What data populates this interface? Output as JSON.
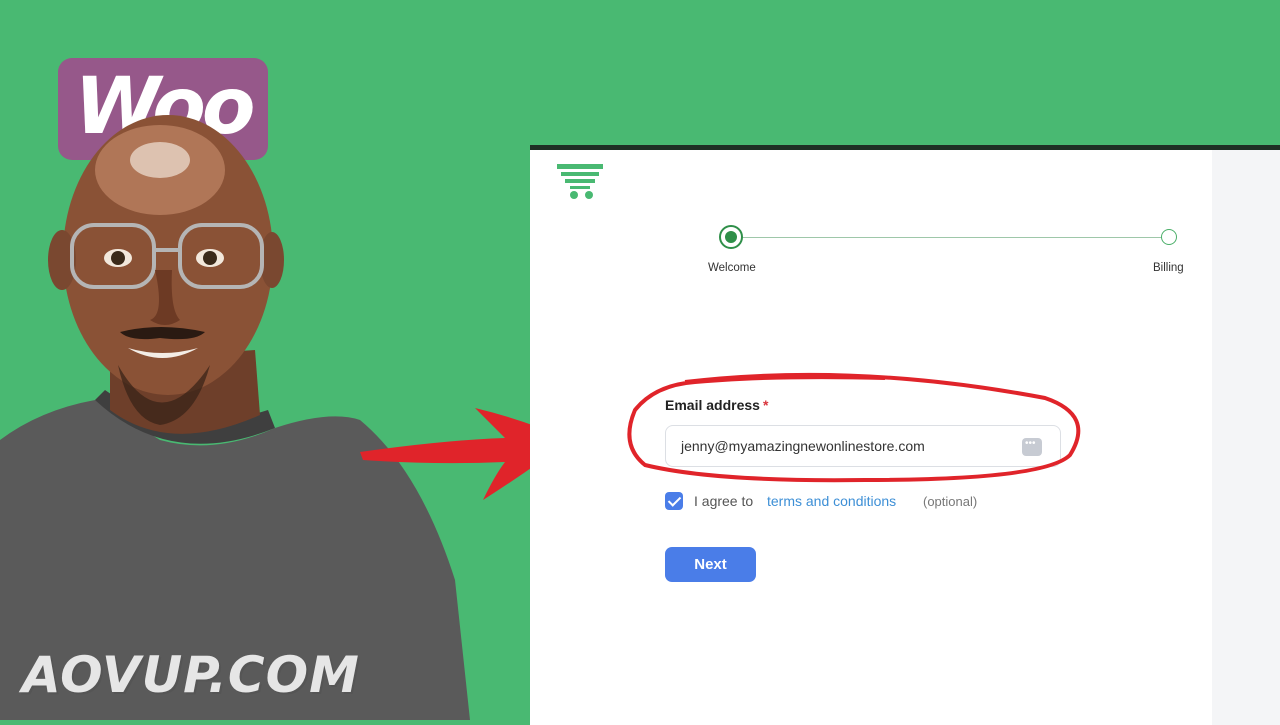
{
  "left": {
    "logo_text": "Woo",
    "watermark": "AOVUP.COM"
  },
  "app": {
    "steps": [
      {
        "label": "Welcome",
        "state": "active"
      },
      {
        "label": "Billing",
        "state": "inactive"
      }
    ],
    "email": {
      "label": "Email address",
      "required_mark": "*",
      "value": "jenny@myamazingnewonlinestore.com"
    },
    "agree": {
      "checked": true,
      "text": "I agree to",
      "link": "terms and conditions",
      "optional": "(optional)"
    },
    "next_label": "Next"
  },
  "colors": {
    "background_green": "#49b972",
    "woo_purple": "#96588a",
    "primary_blue": "#4a7de8",
    "step_green": "#2f8f49",
    "annotation_red": "#e0242a"
  }
}
